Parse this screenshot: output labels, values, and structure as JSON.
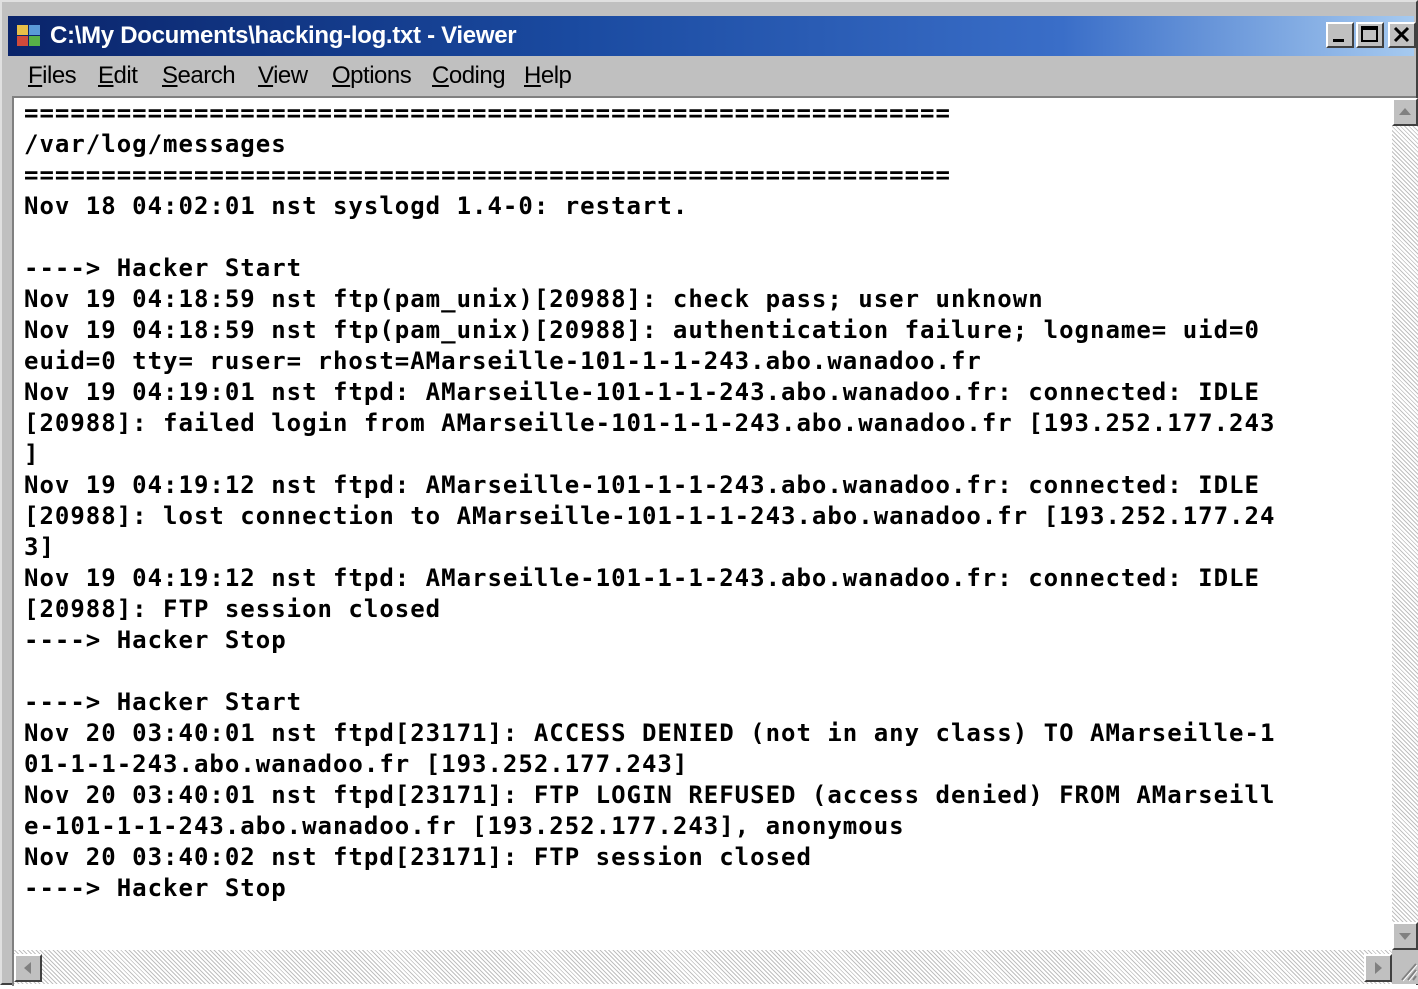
{
  "window": {
    "title": "C:\\My Documents\\hacking-log.txt - Viewer"
  },
  "menu": [
    {
      "accel": "F",
      "rest": "iles"
    },
    {
      "accel": "E",
      "rest": "dit"
    },
    {
      "accel": "S",
      "rest": "earch"
    },
    {
      "accel": "V",
      "rest": "iew"
    },
    {
      "accel": "O",
      "rest": "ptions"
    },
    {
      "accel": "C",
      "rest": "oding"
    },
    {
      "accel": "H",
      "rest": "elp"
    }
  ],
  "document": {
    "lines": [
      "============================================================",
      "/var/log/messages",
      "============================================================",
      "Nov 18 04:02:01 nst syslogd 1.4-0: restart.",
      "",
      "----> Hacker Start",
      "Nov 19 04:18:59 nst ftp(pam_unix)[20988]: check pass; user unknown",
      "Nov 19 04:18:59 nst ftp(pam_unix)[20988]: authentication failure; logname= uid=0",
      "euid=0 tty= ruser= rhost=AMarseille-101-1-1-243.abo.wanadoo.fr",
      "Nov 19 04:19:01 nst ftpd: AMarseille-101-1-1-243.abo.wanadoo.fr: connected: IDLE",
      "[20988]: failed login from AMarseille-101-1-1-243.abo.wanadoo.fr [193.252.177.243",
      "]",
      "Nov 19 04:19:12 nst ftpd: AMarseille-101-1-1-243.abo.wanadoo.fr: connected: IDLE",
      "[20988]: lost connection to AMarseille-101-1-1-243.abo.wanadoo.fr [193.252.177.24",
      "3]",
      "Nov 19 04:19:12 nst ftpd: AMarseille-101-1-1-243.abo.wanadoo.fr: connected: IDLE",
      "[20988]: FTP session closed",
      "----> Hacker Stop",
      "",
      "----> Hacker Start",
      "Nov 20 03:40:01 nst ftpd[23171]: ACCESS DENIED (not in any class) TO AMarseille-1",
      "01-1-1-243.abo.wanadoo.fr [193.252.177.243]",
      "Nov 20 03:40:01 nst ftpd[23171]: FTP LOGIN REFUSED (access denied) FROM AMarseill",
      "e-101-1-1-243.abo.wanadoo.fr [193.252.177.243], anonymous",
      "Nov 20 03:40:02 nst ftpd[23171]: FTP session closed",
      "----> Hacker Stop"
    ]
  }
}
